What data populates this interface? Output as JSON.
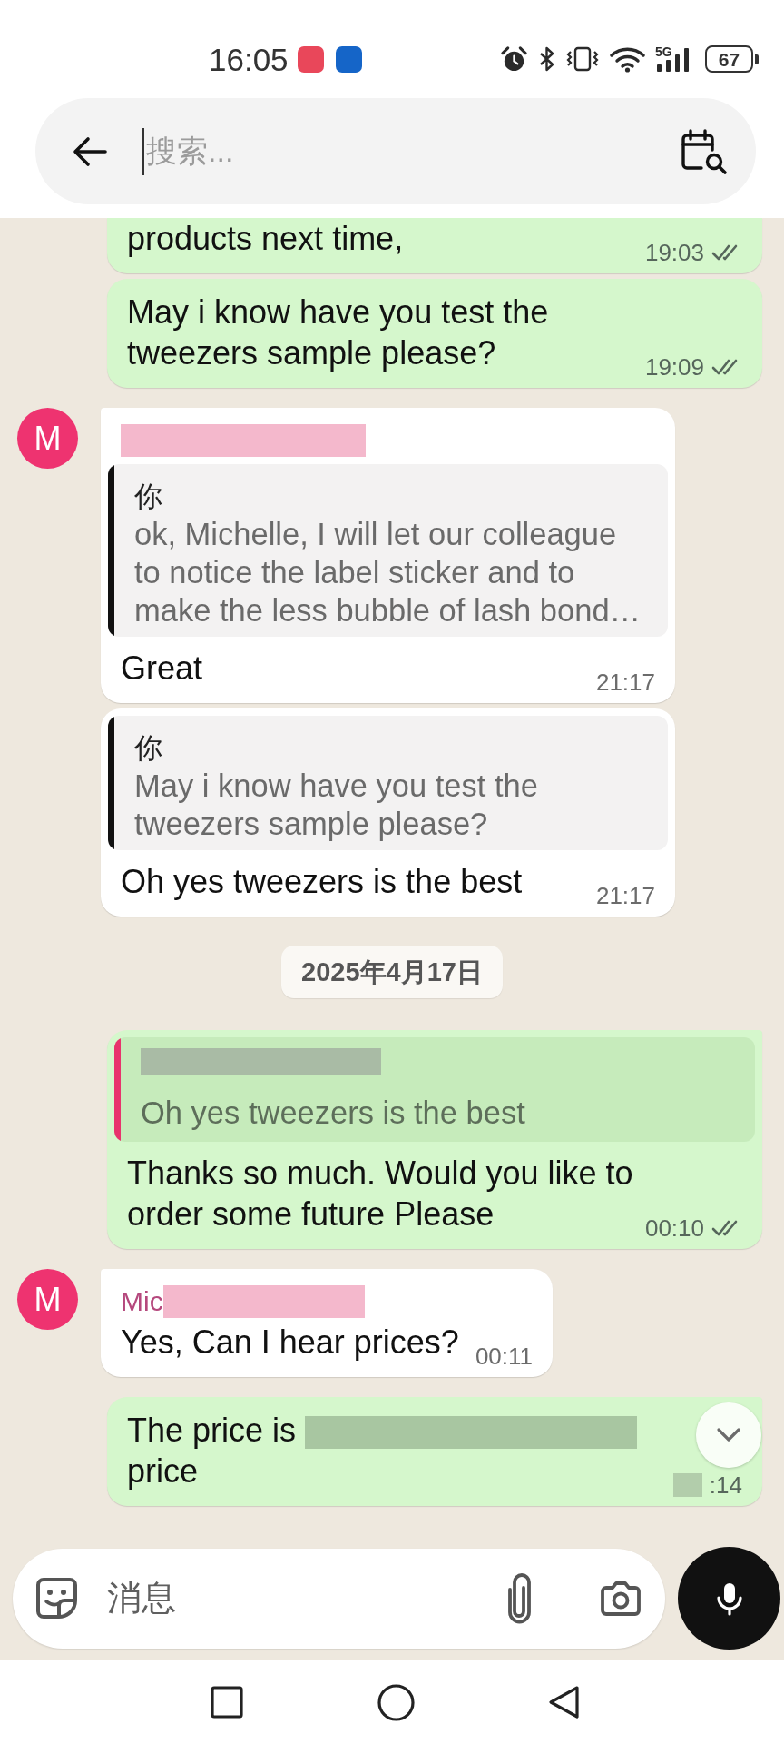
{
  "status_bar": {
    "time": "16:05",
    "notification_icons": [
      {
        "color": "#e9475a"
      },
      {
        "color": "#1565c8"
      }
    ],
    "network": "5G",
    "battery": "67"
  },
  "search": {
    "placeholder": "搜索...",
    "focused": true
  },
  "messages": [
    {
      "kind": "sent",
      "cut_top": true,
      "text": "products next time,",
      "time": "19:03",
      "delivered": true
    },
    {
      "kind": "sent",
      "tail": false,
      "text": "May i know have you test the tweezers sample please?",
      "time": "19:09",
      "delivered": true
    },
    {
      "kind": "received",
      "tail": true,
      "avatar": "M",
      "sender_redacted": true,
      "quote": {
        "author": "你",
        "color": "#111111",
        "text": "ok, Michelle, I will let our colleague to notice the label sticker and to make the less bubble of lash bond…"
      },
      "text": "Great",
      "time": "21:17"
    },
    {
      "kind": "received",
      "tail": false,
      "quote": {
        "author": "你",
        "color": "#111111",
        "text": "May i know have you test the tweezers sample please?"
      },
      "text": "Oh yes tweezers is the best",
      "time": "21:17"
    },
    {
      "kind": "date",
      "text": "2025年4月17日"
    },
    {
      "kind": "sent",
      "tail": true,
      "quote": {
        "author_redacted": true,
        "color": "#e8336d",
        "text": "Oh yes tweezers is the best"
      },
      "text": "Thanks so much. Would you like to order some future Please",
      "time": "00:10",
      "delivered": true
    },
    {
      "kind": "received",
      "tail": true,
      "avatar": "M",
      "sender": "Mic",
      "sender_redacted": true,
      "text": "Yes, Can I hear prices?",
      "time": "00:11"
    },
    {
      "kind": "sent",
      "tail": true,
      "segments": [
        {
          "kind": "text",
          "text": "The price is"
        },
        {
          "kind": "redacted"
        },
        {
          "kind": "text",
          "text": "price"
        }
      ],
      "time": ":14",
      "time_redacted": true
    }
  ],
  "composer": {
    "placeholder": "消息"
  }
}
